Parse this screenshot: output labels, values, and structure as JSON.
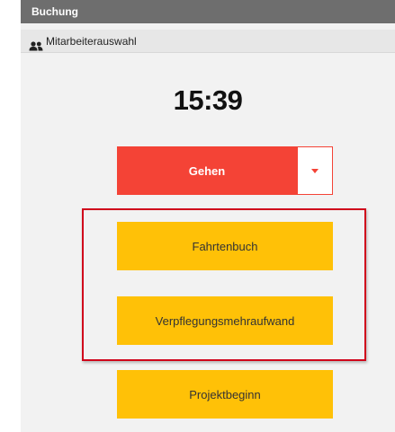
{
  "window": {
    "title": "Buchung"
  },
  "subbar": {
    "label": "Mitarbeiterauswahl",
    "icon": "users-icon"
  },
  "clock": {
    "time": "15:39"
  },
  "primary_action": {
    "label": "Gehen",
    "color": "#f44336",
    "dropdown_icon": "caret-down-icon"
  },
  "actions": [
    {
      "label": "Fahrtenbuch"
    },
    {
      "label": "Verpflegungsmehraufwand"
    },
    {
      "label": "Projektbeginn"
    }
  ],
  "colors": {
    "titlebar": "#6e6e6e",
    "action_yellow": "#ffc107",
    "highlight_border": "#d0021b"
  }
}
